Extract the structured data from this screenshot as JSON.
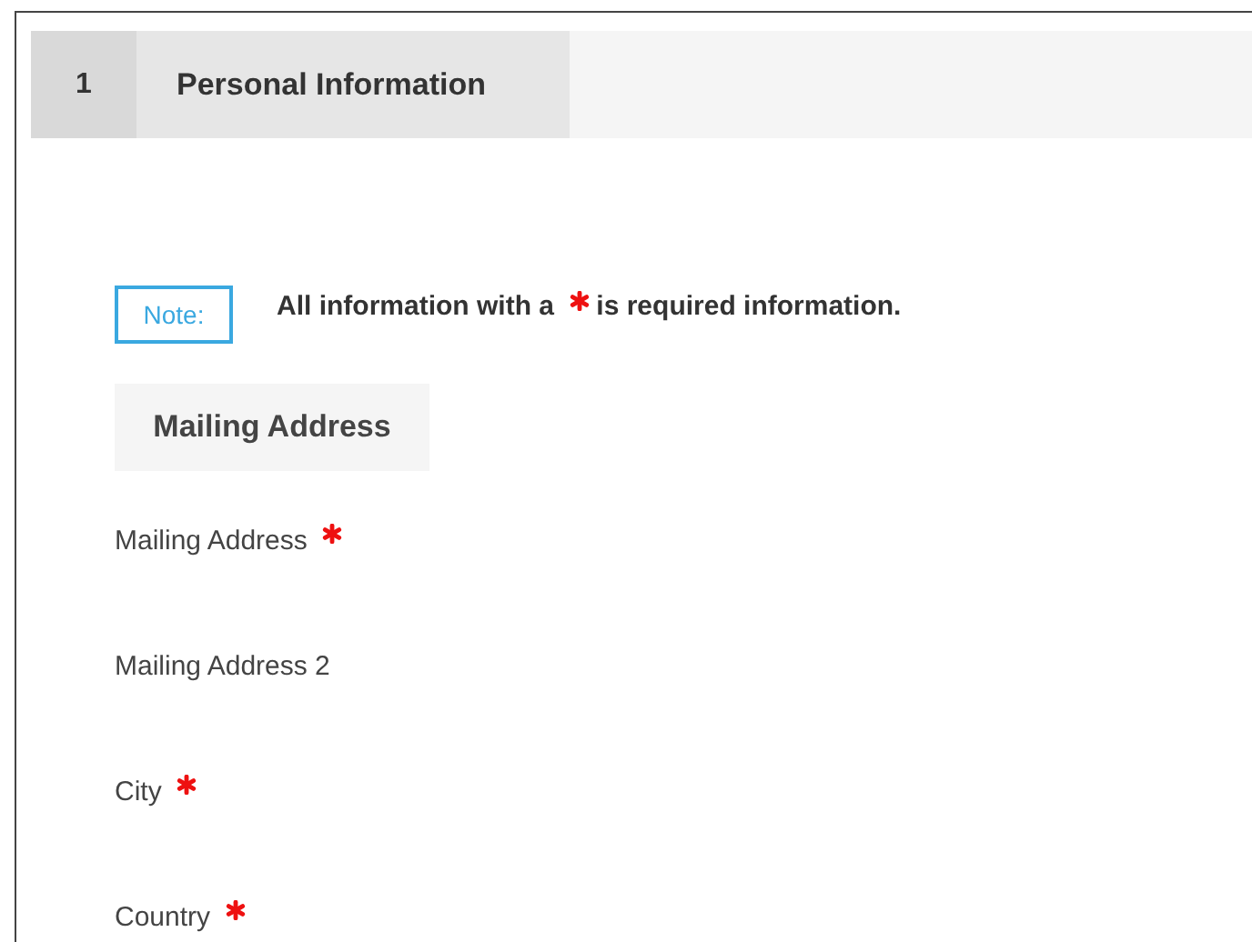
{
  "step": {
    "number": "1",
    "title": "Personal Information"
  },
  "note": {
    "label": "Note:",
    "before": "All information with a",
    "after": "is required information."
  },
  "section": {
    "title": "Mailing Address"
  },
  "fields": [
    {
      "label": "Mailing Address",
      "required": true
    },
    {
      "label": "Mailing Address 2",
      "required": false
    },
    {
      "label": "City",
      "required": true
    },
    {
      "label": "Country",
      "required": true
    }
  ]
}
